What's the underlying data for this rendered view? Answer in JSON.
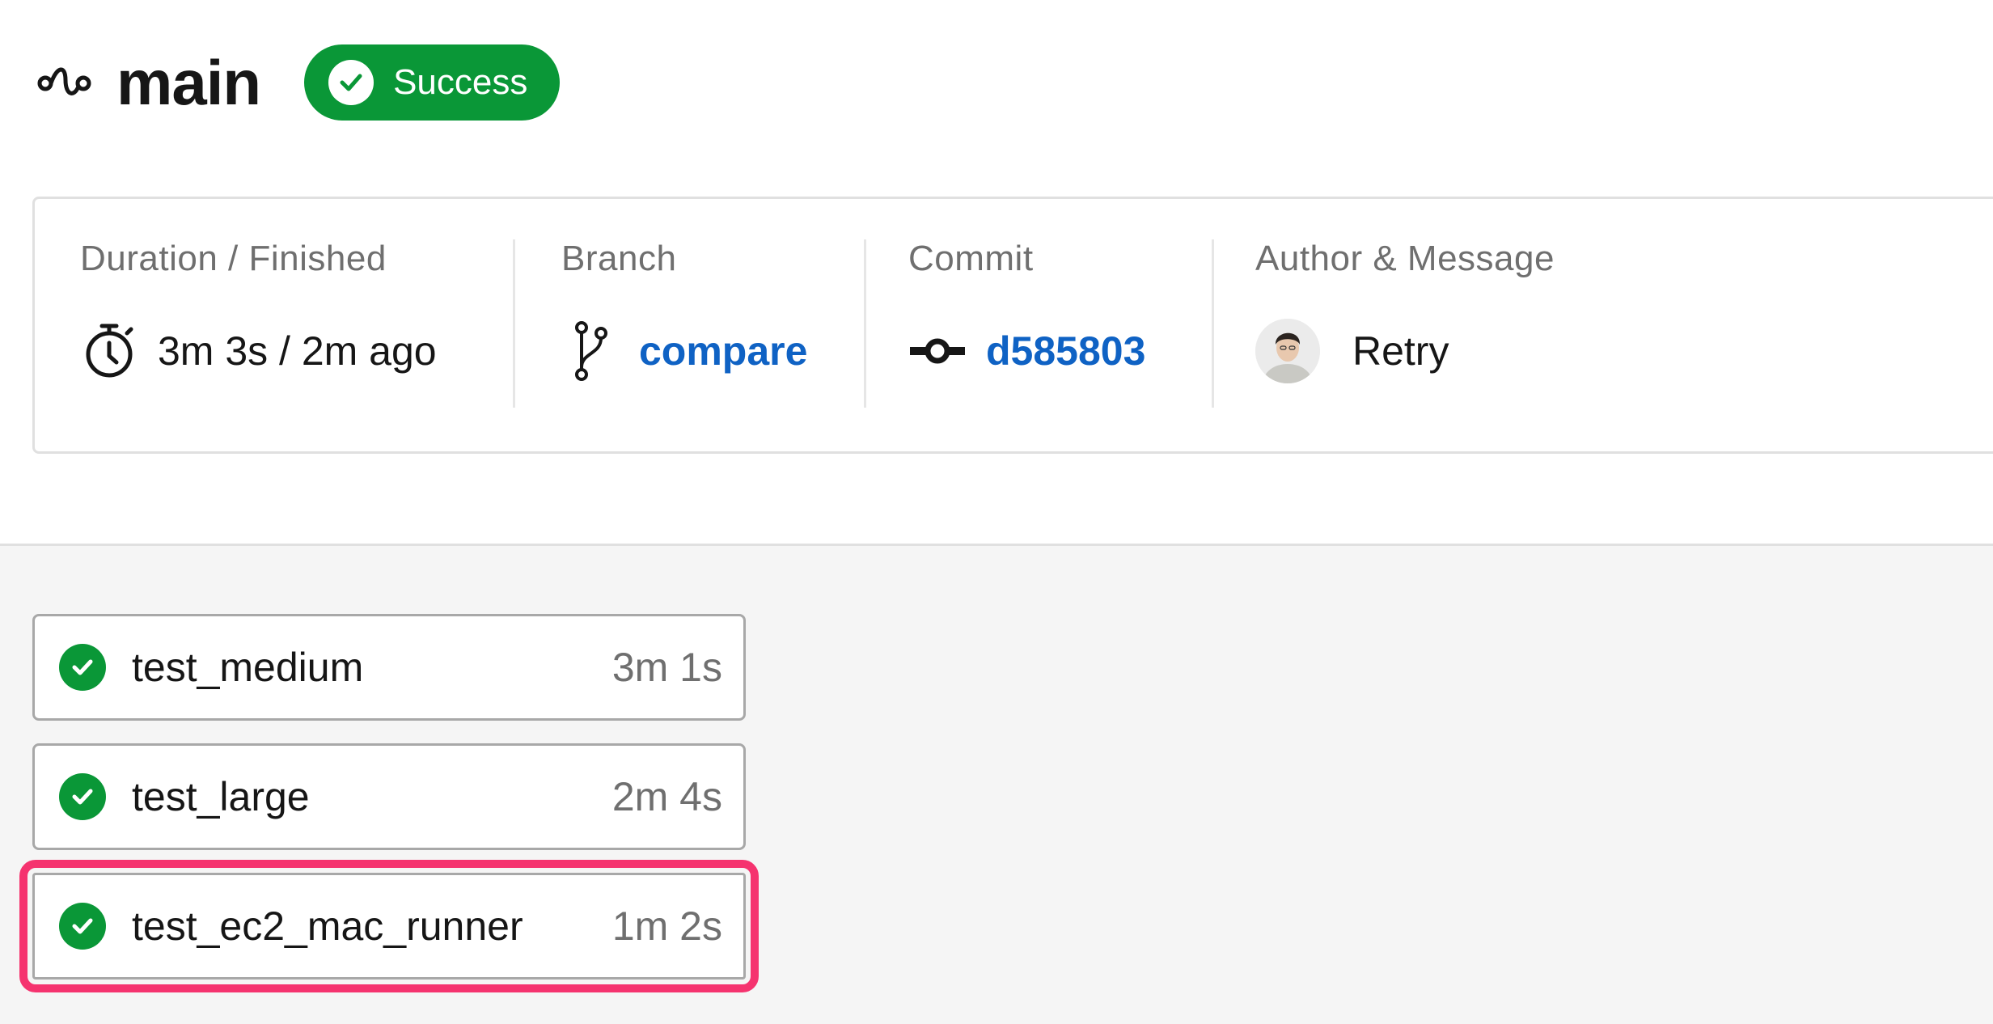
{
  "pipeline": {
    "title": "main",
    "icon": "pipeline-icon",
    "status": {
      "label": "Success",
      "color": "#0a9737",
      "icon": "check-circle-icon"
    }
  },
  "info": {
    "duration": {
      "label": "Duration / Finished",
      "value": "3m 3s / 2m ago",
      "icon": "timer-icon"
    },
    "branch": {
      "label": "Branch",
      "value": "compare",
      "icon": "branch-icon"
    },
    "commit": {
      "label": "Commit",
      "value": "d585803",
      "icon": "commit-icon"
    },
    "author": {
      "label": "Author & Message",
      "message": "Retry",
      "icon": "avatar"
    }
  },
  "jobs": [
    {
      "name": "test_medium",
      "duration": "3m 1s",
      "status": "success"
    },
    {
      "name": "test_large",
      "duration": "2m 4s",
      "status": "success"
    },
    {
      "name": "test_ec2_mac_runner",
      "duration": "1m 2s",
      "status": "success",
      "highlighted": true
    }
  ],
  "colors": {
    "success": "#0a9737",
    "link": "#0f62c4",
    "highlight": "#f5336f"
  }
}
